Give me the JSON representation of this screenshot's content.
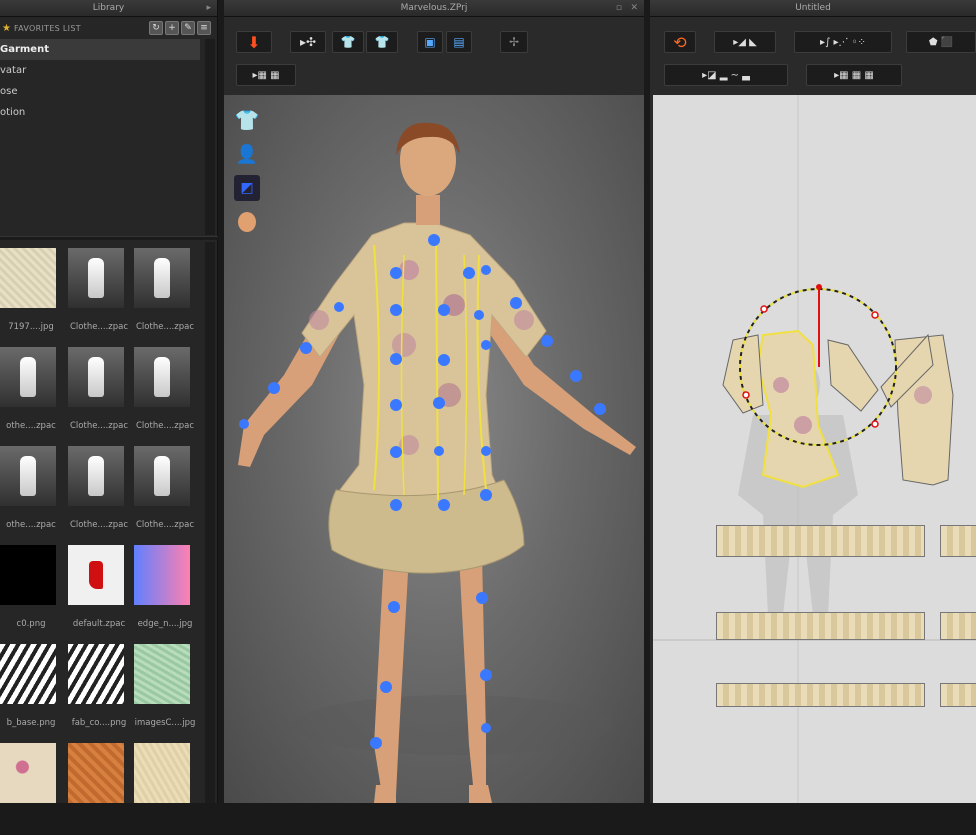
{
  "library": {
    "title": "Library",
    "favorites_label": "FAVORITES LIST",
    "tree": [
      {
        "label": "Garment",
        "selected": true
      },
      {
        "label": "vatar"
      },
      {
        "label": "ose"
      },
      {
        "label": "otion"
      }
    ],
    "thumbnails": [
      {
        "caption": "7197....jpg",
        "kind": "fabric"
      },
      {
        "caption": "Clothe....zpac",
        "kind": "dark"
      },
      {
        "caption": "Clothe....zpac",
        "kind": "dark"
      },
      {
        "caption": "othe....zpac",
        "kind": "dark"
      },
      {
        "caption": "Clothe....zpac",
        "kind": "dark"
      },
      {
        "caption": "Clothe....zpac",
        "kind": "dark"
      },
      {
        "caption": "othe....zpac",
        "kind": "dark"
      },
      {
        "caption": "Clothe....zpac",
        "kind": "dark"
      },
      {
        "caption": "Clothe....zpac",
        "kind": "dark"
      },
      {
        "caption": "c0.png",
        "kind": "black"
      },
      {
        "caption": "default.zpac",
        "kind": "red"
      },
      {
        "caption": "edge_n....jpg",
        "kind": "grad"
      },
      {
        "caption": "b_base.png",
        "kind": "bw"
      },
      {
        "caption": "fab_co....png",
        "kind": "bw"
      },
      {
        "caption": "imagesC....jpg",
        "kind": "green"
      },
      {
        "caption": "",
        "kind": "floral"
      },
      {
        "caption": "",
        "kind": "orange"
      },
      {
        "caption": "",
        "kind": "beige"
      }
    ]
  },
  "view3d": {
    "title": "Marvelous.ZPrj"
  },
  "view2d": {
    "title": "Untitled"
  },
  "icons": {
    "pin": "pin-icon",
    "refresh": "refresh-icon",
    "add": "add-icon",
    "edit": "edit-icon",
    "list": "list-icon"
  }
}
